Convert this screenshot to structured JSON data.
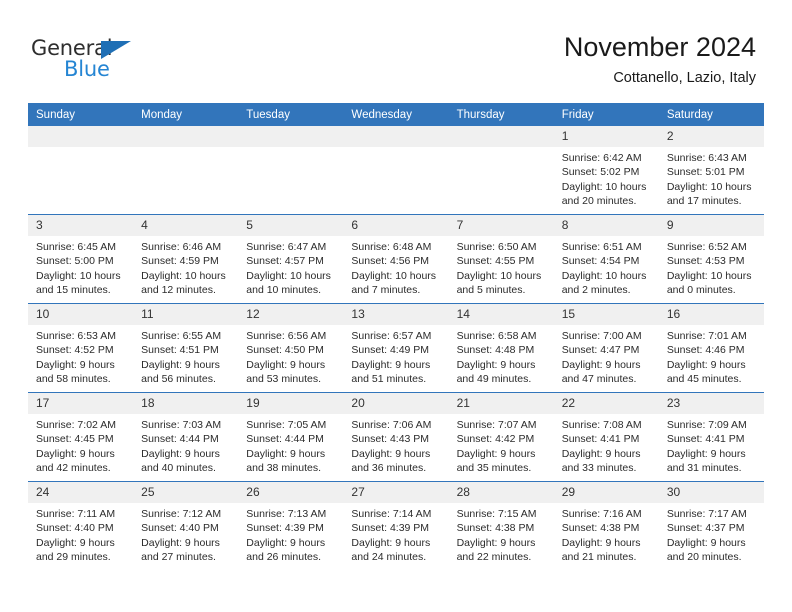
{
  "brand": {
    "name_top": "General",
    "name_bottom": "Blue",
    "accent_color": "#2585d3",
    "triangle_color": "#1f6fb5"
  },
  "header": {
    "title": "November 2024",
    "subtitle": "Cottanello, Lazio, Italy"
  },
  "calendar": {
    "header_bg": "#3275bb",
    "daynum_bg": "#f0f0f0",
    "weekday_headers": [
      "Sunday",
      "Monday",
      "Tuesday",
      "Wednesday",
      "Thursday",
      "Friday",
      "Saturday"
    ],
    "weeks": [
      [
        {
          "day": "",
          "sunrise": "",
          "sunset": "",
          "daylight": ""
        },
        {
          "day": "",
          "sunrise": "",
          "sunset": "",
          "daylight": ""
        },
        {
          "day": "",
          "sunrise": "",
          "sunset": "",
          "daylight": ""
        },
        {
          "day": "",
          "sunrise": "",
          "sunset": "",
          "daylight": ""
        },
        {
          "day": "",
          "sunrise": "",
          "sunset": "",
          "daylight": ""
        },
        {
          "day": "1",
          "sunrise": "Sunrise: 6:42 AM",
          "sunset": "Sunset: 5:02 PM",
          "daylight": "Daylight: 10 hours and 20 minutes."
        },
        {
          "day": "2",
          "sunrise": "Sunrise: 6:43 AM",
          "sunset": "Sunset: 5:01 PM",
          "daylight": "Daylight: 10 hours and 17 minutes."
        }
      ],
      [
        {
          "day": "3",
          "sunrise": "Sunrise: 6:45 AM",
          "sunset": "Sunset: 5:00 PM",
          "daylight": "Daylight: 10 hours and 15 minutes."
        },
        {
          "day": "4",
          "sunrise": "Sunrise: 6:46 AM",
          "sunset": "Sunset: 4:59 PM",
          "daylight": "Daylight: 10 hours and 12 minutes."
        },
        {
          "day": "5",
          "sunrise": "Sunrise: 6:47 AM",
          "sunset": "Sunset: 4:57 PM",
          "daylight": "Daylight: 10 hours and 10 minutes."
        },
        {
          "day": "6",
          "sunrise": "Sunrise: 6:48 AM",
          "sunset": "Sunset: 4:56 PM",
          "daylight": "Daylight: 10 hours and 7 minutes."
        },
        {
          "day": "7",
          "sunrise": "Sunrise: 6:50 AM",
          "sunset": "Sunset: 4:55 PM",
          "daylight": "Daylight: 10 hours and 5 minutes."
        },
        {
          "day": "8",
          "sunrise": "Sunrise: 6:51 AM",
          "sunset": "Sunset: 4:54 PM",
          "daylight": "Daylight: 10 hours and 2 minutes."
        },
        {
          "day": "9",
          "sunrise": "Sunrise: 6:52 AM",
          "sunset": "Sunset: 4:53 PM",
          "daylight": "Daylight: 10 hours and 0 minutes."
        }
      ],
      [
        {
          "day": "10",
          "sunrise": "Sunrise: 6:53 AM",
          "sunset": "Sunset: 4:52 PM",
          "daylight": "Daylight: 9 hours and 58 minutes."
        },
        {
          "day": "11",
          "sunrise": "Sunrise: 6:55 AM",
          "sunset": "Sunset: 4:51 PM",
          "daylight": "Daylight: 9 hours and 56 minutes."
        },
        {
          "day": "12",
          "sunrise": "Sunrise: 6:56 AM",
          "sunset": "Sunset: 4:50 PM",
          "daylight": "Daylight: 9 hours and 53 minutes."
        },
        {
          "day": "13",
          "sunrise": "Sunrise: 6:57 AM",
          "sunset": "Sunset: 4:49 PM",
          "daylight": "Daylight: 9 hours and 51 minutes."
        },
        {
          "day": "14",
          "sunrise": "Sunrise: 6:58 AM",
          "sunset": "Sunset: 4:48 PM",
          "daylight": "Daylight: 9 hours and 49 minutes."
        },
        {
          "day": "15",
          "sunrise": "Sunrise: 7:00 AM",
          "sunset": "Sunset: 4:47 PM",
          "daylight": "Daylight: 9 hours and 47 minutes."
        },
        {
          "day": "16",
          "sunrise": "Sunrise: 7:01 AM",
          "sunset": "Sunset: 4:46 PM",
          "daylight": "Daylight: 9 hours and 45 minutes."
        }
      ],
      [
        {
          "day": "17",
          "sunrise": "Sunrise: 7:02 AM",
          "sunset": "Sunset: 4:45 PM",
          "daylight": "Daylight: 9 hours and 42 minutes."
        },
        {
          "day": "18",
          "sunrise": "Sunrise: 7:03 AM",
          "sunset": "Sunset: 4:44 PM",
          "daylight": "Daylight: 9 hours and 40 minutes."
        },
        {
          "day": "19",
          "sunrise": "Sunrise: 7:05 AM",
          "sunset": "Sunset: 4:44 PM",
          "daylight": "Daylight: 9 hours and 38 minutes."
        },
        {
          "day": "20",
          "sunrise": "Sunrise: 7:06 AM",
          "sunset": "Sunset: 4:43 PM",
          "daylight": "Daylight: 9 hours and 36 minutes."
        },
        {
          "day": "21",
          "sunrise": "Sunrise: 7:07 AM",
          "sunset": "Sunset: 4:42 PM",
          "daylight": "Daylight: 9 hours and 35 minutes."
        },
        {
          "day": "22",
          "sunrise": "Sunrise: 7:08 AM",
          "sunset": "Sunset: 4:41 PM",
          "daylight": "Daylight: 9 hours and 33 minutes."
        },
        {
          "day": "23",
          "sunrise": "Sunrise: 7:09 AM",
          "sunset": "Sunset: 4:41 PM",
          "daylight": "Daylight: 9 hours and 31 minutes."
        }
      ],
      [
        {
          "day": "24",
          "sunrise": "Sunrise: 7:11 AM",
          "sunset": "Sunset: 4:40 PM",
          "daylight": "Daylight: 9 hours and 29 minutes."
        },
        {
          "day": "25",
          "sunrise": "Sunrise: 7:12 AM",
          "sunset": "Sunset: 4:40 PM",
          "daylight": "Daylight: 9 hours and 27 minutes."
        },
        {
          "day": "26",
          "sunrise": "Sunrise: 7:13 AM",
          "sunset": "Sunset: 4:39 PM",
          "daylight": "Daylight: 9 hours and 26 minutes."
        },
        {
          "day": "27",
          "sunrise": "Sunrise: 7:14 AM",
          "sunset": "Sunset: 4:39 PM",
          "daylight": "Daylight: 9 hours and 24 minutes."
        },
        {
          "day": "28",
          "sunrise": "Sunrise: 7:15 AM",
          "sunset": "Sunset: 4:38 PM",
          "daylight": "Daylight: 9 hours and 22 minutes."
        },
        {
          "day": "29",
          "sunrise": "Sunrise: 7:16 AM",
          "sunset": "Sunset: 4:38 PM",
          "daylight": "Daylight: 9 hours and 21 minutes."
        },
        {
          "day": "30",
          "sunrise": "Sunrise: 7:17 AM",
          "sunset": "Sunset: 4:37 PM",
          "daylight": "Daylight: 9 hours and 20 minutes."
        }
      ]
    ]
  }
}
